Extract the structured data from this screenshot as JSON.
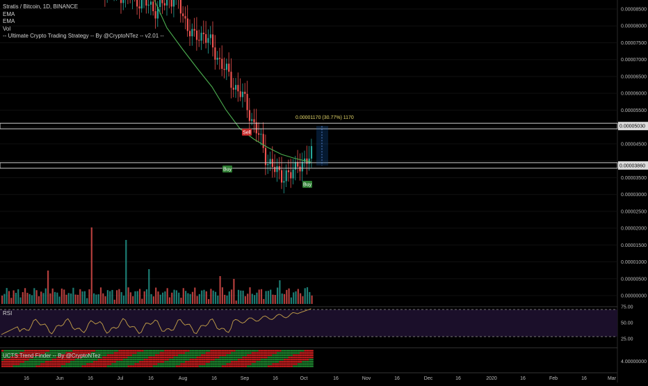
{
  "legend": {
    "symbol": "Stratis / Bitcoin, 1D, BINANCE",
    "ema1": "EMA",
    "ema2": "EMA",
    "vol": "Vol",
    "strategy": "-- Ultimate Crypto Trading Strategy -- By @CryptoNTez -- v2.01 --"
  },
  "measure_label": "0.00001170 (30.77%) 1170",
  "signals": [
    "Sell",
    "Buy",
    "Buy"
  ],
  "price_axis": [
    "0.00008500",
    "0.00008000",
    "0.00007500",
    "0.00007000",
    "0.00006500",
    "0.00006000",
    "0.00005500",
    "0.00005030",
    "0.00004500",
    "0.00003860",
    "0.00003500",
    "0.00003000",
    "0.00002500",
    "0.00002000",
    "0.00001500",
    "0.00001000",
    "0.00000500",
    "0.00000000"
  ],
  "price_tags": {
    "upper": "0.00005030",
    "lower": "0.00003860"
  },
  "rsi": {
    "title": "RSI",
    "levels": [
      "75.00",
      "50.00",
      "25.00"
    ]
  },
  "trend_finder": {
    "title": "UCTS Trend Finder -- By @CryptoNTez",
    "value": "4.00000000"
  },
  "time_axis": [
    "16",
    "Jun",
    "16",
    "Jul",
    "16",
    "Aug",
    "16",
    "Sep",
    "16",
    "Oct",
    "16",
    "Nov",
    "16",
    "Dec",
    "16",
    "2020",
    "16",
    "Feb",
    "16",
    "Mar"
  ],
  "colors": {
    "up": "#26a69a",
    "down": "#ef5350",
    "ema": "#4caf50",
    "rsi_line": "#c9a44a",
    "rsi_bg": "#1b0f2a",
    "band": "#cfcfcf",
    "measure": "#e6d86a"
  }
}
